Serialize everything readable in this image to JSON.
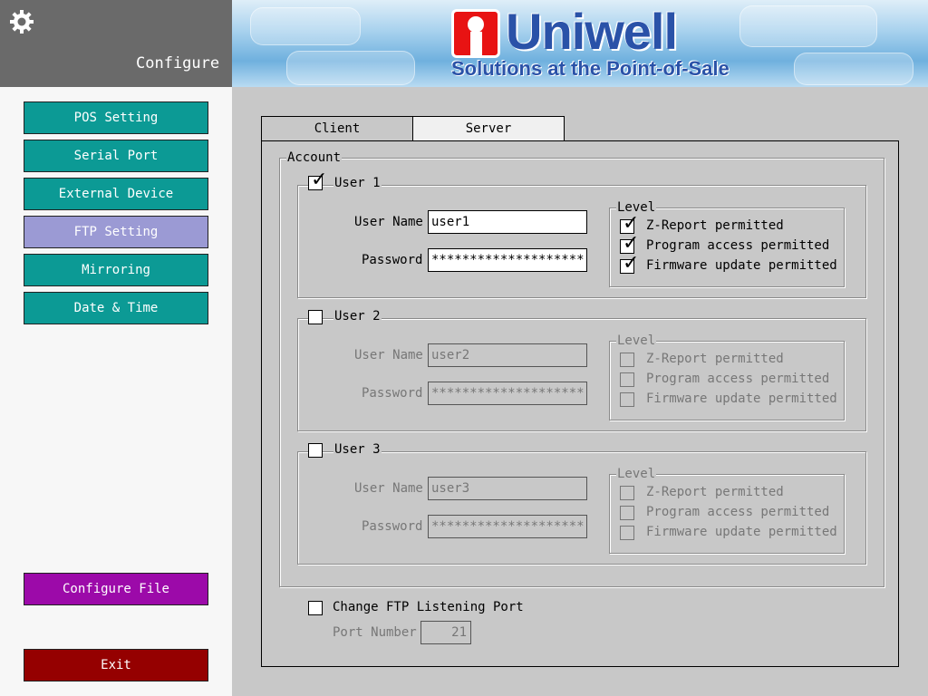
{
  "header": {
    "title": "Configure",
    "brand": "Uniwell",
    "tagline": "Solutions at the Point-of-Sale"
  },
  "sidebar": {
    "items": [
      {
        "label": "POS Setting",
        "active": false
      },
      {
        "label": "Serial Port",
        "active": false
      },
      {
        "label": "External Device",
        "active": false
      },
      {
        "label": "FTP Setting",
        "active": true
      },
      {
        "label": "Mirroring",
        "active": false
      },
      {
        "label": "Date & Time",
        "active": false
      }
    ],
    "configure_file": "Configure File",
    "exit": "Exit"
  },
  "tabs": [
    {
      "label": "Client",
      "selected": false
    },
    {
      "label": "Server",
      "selected": true
    }
  ],
  "account": {
    "legend": "Account",
    "users": [
      {
        "label": "User 1",
        "enabled": true,
        "user_name_label": "User Name",
        "user_name": "user1",
        "password_label": "Password",
        "password": "********************",
        "level_legend": "Level",
        "levels": [
          {
            "label": "Z-Report permitted",
            "checked": true
          },
          {
            "label": "Program access permitted",
            "checked": true
          },
          {
            "label": "Firmware update permitted",
            "checked": true
          }
        ]
      },
      {
        "label": "User 2",
        "enabled": false,
        "user_name_label": "User Name",
        "user_name": "user2",
        "password_label": "Password",
        "password": "********************",
        "level_legend": "Level",
        "levels": [
          {
            "label": "Z-Report permitted",
            "checked": false
          },
          {
            "label": "Program access permitted",
            "checked": false
          },
          {
            "label": "Firmware update permitted",
            "checked": false
          }
        ]
      },
      {
        "label": "User 3",
        "enabled": false,
        "user_name_label": "User Name",
        "user_name": "user3",
        "password_label": "Password",
        "password": "********************",
        "level_legend": "Level",
        "levels": [
          {
            "label": "Z-Report permitted",
            "checked": false
          },
          {
            "label": "Program access permitted",
            "checked": false
          },
          {
            "label": "Firmware update permitted",
            "checked": false
          }
        ]
      }
    ]
  },
  "ftp_port": {
    "label": "Change FTP Listening Port",
    "checked": false,
    "port_label": "Port Number",
    "port_value": "21"
  },
  "colors": {
    "teal": "#0c9a95",
    "active": "#9b9ad4",
    "configure_file": "#9c0aa9",
    "exit": "#950000",
    "brand": "#2a52a8"
  }
}
